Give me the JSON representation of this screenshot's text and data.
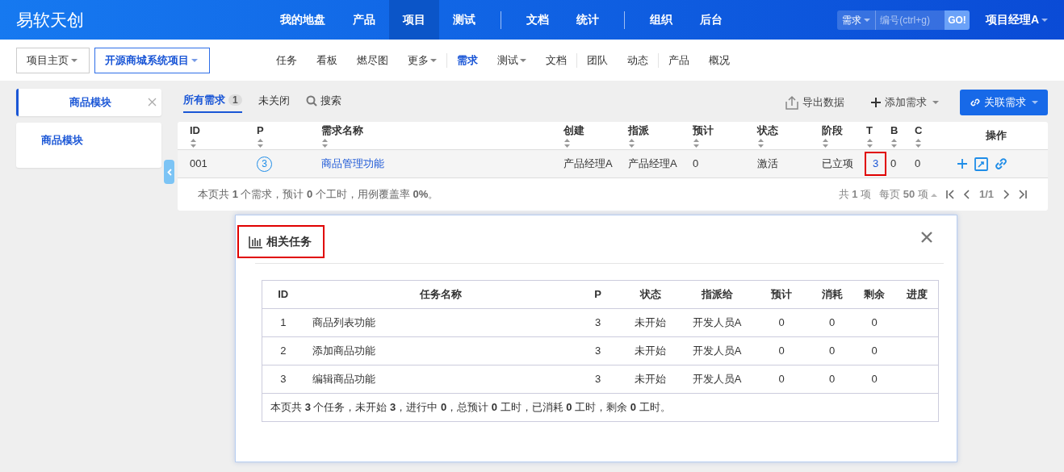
{
  "brand": "易软天创",
  "main_nav": [
    [
      {
        "label": "我的地盘",
        "selected": false
      },
      {
        "label": "产品",
        "selected": false
      },
      {
        "label": "项目",
        "selected": true
      },
      {
        "label": "测试",
        "selected": false
      }
    ],
    [
      {
        "label": "文档",
        "selected": false
      },
      {
        "label": "统计",
        "selected": false
      }
    ],
    [
      {
        "label": "组织",
        "selected": false
      },
      {
        "label": "后台",
        "selected": false
      }
    ]
  ],
  "quick_search": {
    "type": "需求",
    "placeholder": "编号(ctrl+g)",
    "button": "GO!"
  },
  "user": "项目经理A",
  "breadcrumbs": [
    {
      "label": "项目主页",
      "selected": false
    },
    {
      "label": "开源商城系统项目",
      "selected": true
    }
  ],
  "sub_nav": [
    [
      {
        "label": "任务",
        "selected": false,
        "dropdown": false
      },
      {
        "label": "看板",
        "selected": false,
        "dropdown": false
      },
      {
        "label": "燃尽图",
        "selected": false,
        "dropdown": false
      },
      {
        "label": "更多",
        "selected": false,
        "dropdown": true
      }
    ],
    [
      {
        "label": "需求",
        "selected": true,
        "dropdown": false
      },
      {
        "label": "测试",
        "selected": false,
        "dropdown": true
      },
      {
        "label": "文档",
        "selected": false,
        "dropdown": false
      }
    ],
    [
      {
        "label": "团队",
        "selected": false,
        "dropdown": false
      },
      {
        "label": "动态",
        "selected": false,
        "dropdown": false
      }
    ],
    [
      {
        "label": "产品",
        "selected": false,
        "dropdown": false
      },
      {
        "label": "概况",
        "selected": false,
        "dropdown": false
      }
    ]
  ],
  "sidebar": {
    "tab": "商品模块",
    "tree": [
      {
        "label": "商品模块"
      }
    ]
  },
  "filters": [
    {
      "label": "所有需求",
      "count": "1",
      "selected": true
    },
    {
      "label": "未关闭",
      "selected": false
    }
  ],
  "search_label": "搜索",
  "actions": [
    {
      "label": "导出数据",
      "kind": "export"
    },
    {
      "label": "添加需求",
      "kind": "add"
    },
    {
      "label": "关联需求",
      "kind": "link"
    }
  ],
  "table": {
    "columns": [
      {
        "label": "ID",
        "sortable": true
      },
      {
        "label": "P",
        "sortable": true
      },
      {
        "label": "需求名称",
        "sortable": true
      },
      {
        "label": "创建",
        "sortable": true
      },
      {
        "label": "指派",
        "sortable": true
      },
      {
        "label": "预计",
        "sortable": true
      },
      {
        "label": "状态",
        "sortable": true
      },
      {
        "label": "阶段",
        "sortable": true
      },
      {
        "label": "T",
        "sortable": true
      },
      {
        "label": "B",
        "sortable": true
      },
      {
        "label": "C",
        "sortable": true
      },
      {
        "label": "操作",
        "sortable": false
      }
    ],
    "rows": [
      {
        "cells": [
          {
            "kind": "text",
            "text": "001"
          },
          {
            "kind": "priority",
            "text": "3"
          },
          {
            "kind": "link",
            "text": "商品管理功能"
          },
          {
            "kind": "text",
            "text": "产品经理A"
          },
          {
            "kind": "text",
            "text": "产品经理A"
          },
          {
            "kind": "text",
            "text": "0"
          },
          {
            "kind": "text",
            "text": "激活"
          },
          {
            "kind": "text",
            "text": "已立项"
          },
          {
            "kind": "link",
            "text": "3",
            "highlighted": true
          },
          {
            "kind": "text",
            "text": "0"
          },
          {
            "kind": "text",
            "text": "0"
          },
          {
            "kind": "actions"
          }
        ]
      }
    ],
    "summary": "本页共 **1** 个需求，预计 **0** 个工时，用例覆盖率 **0%**。",
    "pager": {
      "total": "共 **1** 项",
      "per_page": "每页 **50** 项",
      "page": "1/1"
    }
  },
  "modal": {
    "title": "相关任务",
    "highlighted": true,
    "columns": [
      "ID",
      "任务名称",
      "P",
      "状态",
      "指派给",
      "预计",
      "消耗",
      "剩余",
      "进度"
    ],
    "rows": [
      [
        "1",
        "商品列表功能",
        "3",
        "未开始",
        "开发人员A",
        "0",
        "0",
        "0"
      ],
      [
        "2",
        "添加商品功能",
        "3",
        "未开始",
        "开发人员A",
        "0",
        "0",
        "0"
      ],
      [
        "3",
        "编辑商品功能",
        "3",
        "未开始",
        "开发人员A",
        "0",
        "0",
        "0"
      ]
    ],
    "summary": "本页共 **3** 个任务，未开始 **3**，进行中 **0**，总预计 **0** 工时，已消耗 **0** 工时，剩余 **0** 工时。"
  }
}
